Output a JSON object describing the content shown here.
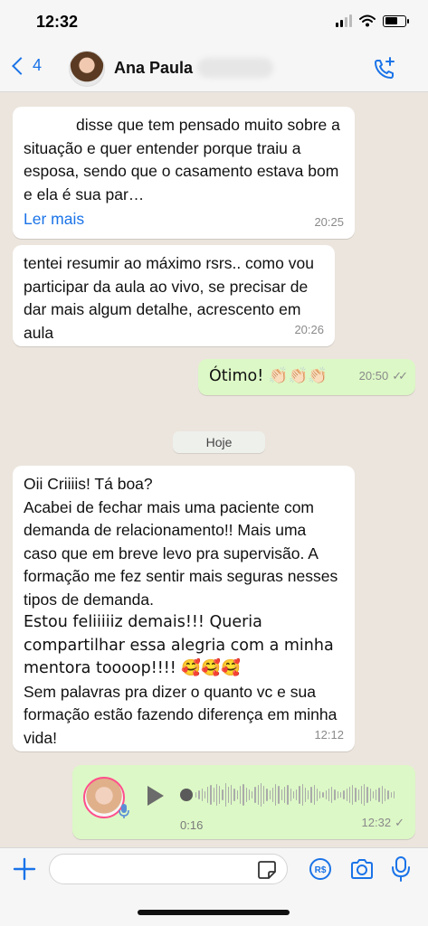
{
  "status_bar": {
    "time": "12:32"
  },
  "header": {
    "back_count": "4",
    "contact_name": "Ana Paula"
  },
  "messages": [
    {
      "direction": "in",
      "text": "disse que tem pensado muito sobre a situação e quer entender porque traiu a esposa, sendo que o casamento estava bom e ela é sua par…",
      "read_more": "Ler mais",
      "time": "20:25"
    },
    {
      "direction": "in",
      "text": "tentei resumir ao máximo rsrs.. como vou participar da aula ao vivo, se precisar de dar mais algum detalhe, acrescento em aula",
      "time": "20:26"
    },
    {
      "direction": "out",
      "text": "Ótimo! 👏🏻👏🏻👏🏻",
      "time": "20:50"
    },
    {
      "direction": "in",
      "lines": [
        "Oii Criiiis! Tá boa?",
        "Acabei de fechar mais uma paciente com demanda de relacionamento!! Mais uma caso que em breve levo pra supervisão. A formação me fez sentir mais seguras nesses tipos de demanda.",
        "Estou feliiiiiz demais!!! Queria compartilhar essa alegria com a minha mentora toooop!!!! 🥰🥰🥰",
        "Sem palavras pra dizer o quanto vc e sua formação estão fazendo diferença em minha vida!"
      ],
      "time": "12:12"
    }
  ],
  "date_separator": "Hoje",
  "voice_note": {
    "duration": "0:16",
    "time": "12:32"
  },
  "icons": {
    "back": "chevron-left-icon",
    "call": "add-call-icon",
    "plus": "plus-icon",
    "sticker": "sticker-icon",
    "pay": "payment-icon",
    "camera": "camera-icon",
    "mic": "microphone-icon"
  },
  "colors": {
    "accent": "#1a73e8",
    "outgoing_bubble": "#dcf8c6",
    "incoming_bubble": "#ffffff",
    "chat_background": "#ece5dd"
  }
}
